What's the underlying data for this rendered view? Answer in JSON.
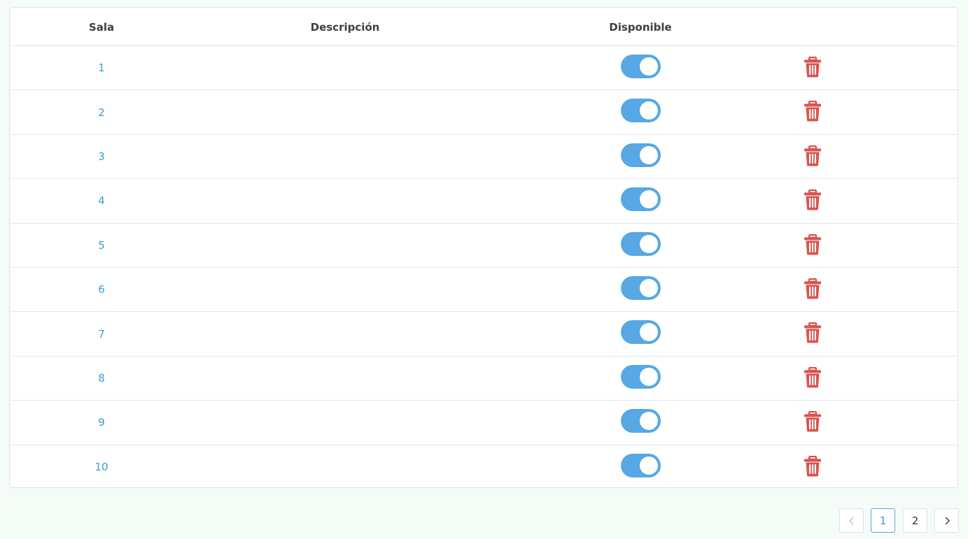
{
  "table": {
    "headers": {
      "sala": "Sala",
      "descripcion": "Descripción",
      "disponible": "Disponible",
      "actions": ""
    },
    "rows": [
      {
        "sala": "1",
        "descripcion": "",
        "disponible": true
      },
      {
        "sala": "2",
        "descripcion": "",
        "disponible": true
      },
      {
        "sala": "3",
        "descripcion": "",
        "disponible": true
      },
      {
        "sala": "4",
        "descripcion": "",
        "disponible": true
      },
      {
        "sala": "5",
        "descripcion": "",
        "disponible": true
      },
      {
        "sala": "6",
        "descripcion": "",
        "disponible": true
      },
      {
        "sala": "7",
        "descripcion": "",
        "disponible": true
      },
      {
        "sala": "8",
        "descripcion": "",
        "disponible": true
      },
      {
        "sala": "9",
        "descripcion": "",
        "disponible": true
      },
      {
        "sala": "10",
        "descripcion": "",
        "disponible": true
      }
    ],
    "row_action_icon": "trash-icon"
  },
  "pagination": {
    "prev_icon": "chevron-left-icon",
    "pages": [
      "1",
      "2"
    ],
    "current_page": "1",
    "next_icon": "chevron-right-icon"
  },
  "colors": {
    "link": "#3d9bd6",
    "toggle_on": "#57a8e4",
    "delete": "#d9534f",
    "background": "#f5fcf8"
  }
}
